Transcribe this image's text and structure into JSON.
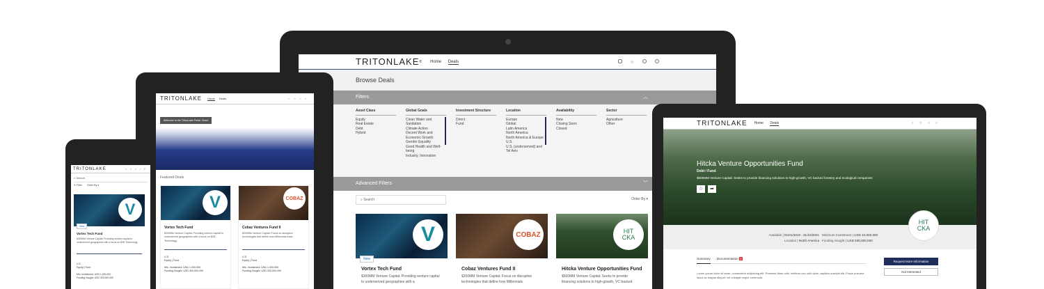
{
  "brand": "TRITONLAKE",
  "nav": {
    "home": "Home",
    "deals": "Deals"
  },
  "desktop": {
    "page_title": "Browse Deals",
    "filters_label": "Filters",
    "advanced_filters_label": "Advanced Filters",
    "search_placeholder": "Search",
    "order_by": "Order By",
    "filter_columns": [
      {
        "heading": "Asset Class",
        "items": [
          "Equity",
          "Real Estate",
          "Debt",
          "Hybrid"
        ]
      },
      {
        "heading": "Global Goals",
        "items": [
          "Clean Water and Sanitation",
          "Climate Action",
          "Decent Work and Economic Growth",
          "Gender Equality",
          "Good Health and Well-being",
          "Industry, Innovation"
        ]
      },
      {
        "heading": "Investment Structure",
        "items": [
          "Direct",
          "Fund"
        ]
      },
      {
        "heading": "Location",
        "items": [
          "Europe",
          "Global",
          "Latin America",
          "North America",
          "North America & Europe",
          "U.S.",
          "U.S. (underserved) and Tel Aviv"
        ]
      },
      {
        "heading": "Availability",
        "items": [
          "New",
          "Closing Soon",
          "Closed"
        ]
      },
      {
        "heading": "Sector",
        "items": [
          "Agriculture",
          "Other"
        ]
      }
    ],
    "cards": [
      {
        "title": "Vortex Tech Fund",
        "badge": "New",
        "desc": "$300MM Venture Capital: Providing venture capital to underserved geographies with a"
      },
      {
        "title": "Cobaz Ventures Fund II",
        "desc": "$200MM Venture Capital: Focus on disruptive technologies that define how Millennials"
      },
      {
        "title": "Hitcka Venture Opportunities Fund",
        "desc": "$500MM Venture Capital: Seeks to provide financing solutions to high-growth, VC backed"
      }
    ]
  },
  "tablet": {
    "welcome": "Welcome to the TritonLake Portal, Sean!",
    "featured": "Featured Deals",
    "cards": [
      {
        "title": "Vortex Tech Fund",
        "desc": "$300MM Venture Capital: Providing venture capital to underserved geographies with a focus on B2B Technology.",
        "location": "U.S.",
        "type": "Equity | Fund",
        "min": "Min. Investment: USD 1,000,000",
        "sought": "Funding Sought: USD 300,000,000"
      },
      {
        "title": "Cobaz Ventures Fund II",
        "desc": "$200MM Venture Capital: Focus on disruptive technologies that define how Millennials trade.",
        "location": "U.S.",
        "type": "Equity | Fund",
        "min": "Min. Investment: USD 1,000,000",
        "sought": "Funding Sought: USD 200,000,000"
      }
    ]
  },
  "phone": {
    "search": "Search",
    "filter": "Filter",
    "order": "Order By",
    "card": {
      "title": "Vortex Tech Fund",
      "badge": "New",
      "desc": "$300MM Venture Capital: Providing venture capital to underserved geographies with a focus on B2B Technology.",
      "location": "U.S.",
      "type": "Equity | Fund",
      "min": "Min. Investment: USD 1,000,000",
      "sought": "Funding Sought: USD 300,000,000"
    }
  },
  "laptop": {
    "fund_title": "Hitcka Venture Opportunities Fund",
    "fund_type": "Debt / Fund",
    "fund_desc": "$500MM Venture Capital: Seeks to provide financing solutions to high-growth, VC backed forestry and ecological companies",
    "available_label": "Available",
    "available_value": "01/01/2019 - 31/10/2021",
    "location_label": "Location",
    "location_value": "North America",
    "min_label": "Minimum Investment",
    "min_value": "USD 10,000,000",
    "sought_label": "Funding Sought",
    "sought_value": "USD 500,000,000",
    "tab_summary": "Summary",
    "tab_docs": "Documentation",
    "docs_count": "2",
    "request_button": "Request More Information",
    "not_interested_button": "Not Interested",
    "lorem": "Lorem ipsum dolor sit amet, consectetur adipiscing elit. Praesent diam odio, eleifend nec odio vitae, dapibus suscipit elit. Fusce posuere lacus ac magna aliquet, vel volutpat neque commodo."
  },
  "logos": {
    "vortex": "V",
    "cobaz": "COBAZ",
    "hitcka_1": "HIT",
    "hitcka_2": "CKA"
  }
}
